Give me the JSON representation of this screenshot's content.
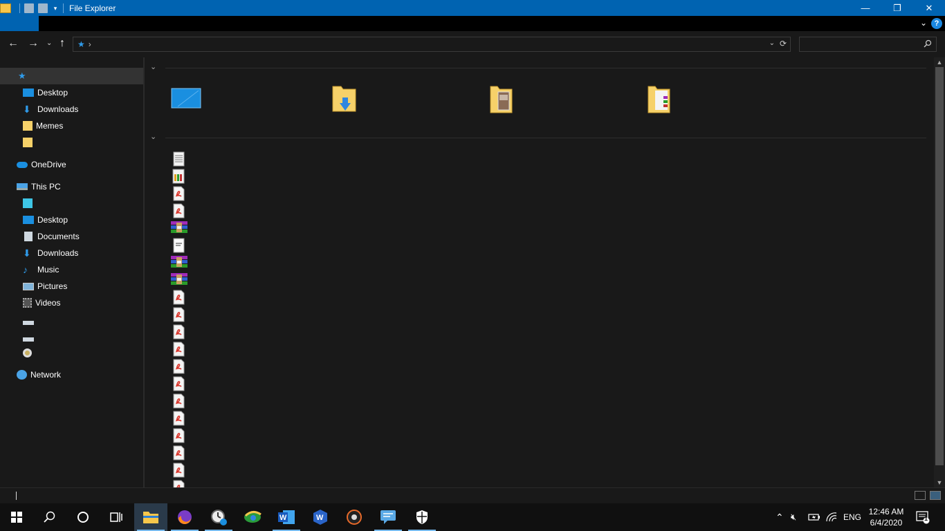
{
  "window": {
    "title": "File Explorer"
  },
  "titlebar": {
    "minimize": "—",
    "maximize": "❐",
    "close": "✕"
  },
  "ribbon": {
    "chevron": "⌄",
    "help": "?"
  },
  "nav": {
    "back": "←",
    "forward": "→",
    "recent": "⌄",
    "up": "↑"
  },
  "address": {
    "location_icon": "quick-access-star",
    "separator": "›",
    "dropdown": "⌄",
    "refresh": "⟳"
  },
  "search": {
    "placeholder": ""
  },
  "sidebar": {
    "items": [
      {
        "label": "",
        "icon": "quick-access-star",
        "selected": true
      },
      {
        "label": "Desktop",
        "icon": "desktop-icon"
      },
      {
        "label": "Downloads",
        "icon": "download-icon"
      },
      {
        "label": "Memes",
        "icon": "folder-icon"
      },
      {
        "label": "",
        "icon": "folder-icon"
      },
      {
        "label": "OneDrive",
        "icon": "cloud-icon"
      },
      {
        "label": "This PC",
        "icon": "computer-icon"
      },
      {
        "label": "",
        "icon": "3d-objects-icon"
      },
      {
        "label": "Desktop",
        "icon": "desktop-icon"
      },
      {
        "label": "Documents",
        "icon": "documents-icon"
      },
      {
        "label": "Downloads",
        "icon": "download-icon"
      },
      {
        "label": "Music",
        "icon": "music-icon"
      },
      {
        "label": "Pictures",
        "icon": "pictures-icon"
      },
      {
        "label": "Videos",
        "icon": "videos-icon"
      },
      {
        "label": "",
        "icon": "drive-icon"
      },
      {
        "label": "",
        "icon": "drive-icon"
      },
      {
        "label": "",
        "icon": "dvd-icon"
      },
      {
        "label": "Network",
        "icon": "network-icon"
      }
    ]
  },
  "content": {
    "group1": {
      "header": "⌄"
    },
    "group2": {
      "header": "⌄"
    }
  },
  "taskbar": {
    "apps": [
      "start",
      "search",
      "cortana",
      "task-view",
      "file-explorer",
      "firefox",
      "clock-app",
      "idm",
      "word",
      "wps",
      "media",
      "chat",
      "defender"
    ]
  },
  "tray": {
    "language": "ENG",
    "time": "12:46 AM",
    "date": "6/4/2020",
    "notification_count": "1"
  },
  "colors": {
    "titlebar": "#0063b1",
    "background": "#191919",
    "accent": "#2f9bea"
  }
}
